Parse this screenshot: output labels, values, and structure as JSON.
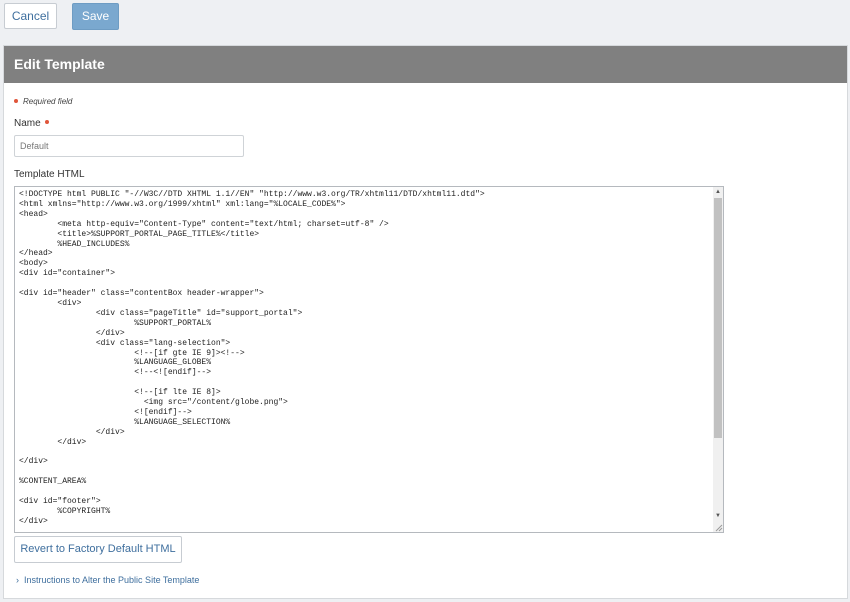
{
  "toolbar": {
    "cancel_label": "Cancel",
    "save_label": "Save"
  },
  "panel": {
    "title": "Edit Template",
    "required_note": "Required field",
    "name_label": "Name",
    "name_value": "Default",
    "template_label": "Template HTML",
    "template_html": "<!DOCTYPE html PUBLIC \"-//W3C//DTD XHTML 1.1//EN\" \"http://www.w3.org/TR/xhtml11/DTD/xhtml11.dtd\">\n<html xmlns=\"http://www.w3.org/1999/xhtml\" xml:lang=\"%LOCALE_CODE%\">\n<head>\n        <meta http-equiv=\"Content-Type\" content=\"text/html; charset=utf-8\" />\n        <title>%SUPPORT_PORTAL_PAGE_TITLE%</title>\n        %HEAD_INCLUDES%\n</head>\n<body>\n<div id=\"container\">\n\n<div id=\"header\" class=\"contentBox header-wrapper\">\n        <div>\n                <div class=\"pageTitle\" id=\"support_portal\">\n                        %SUPPORT_PORTAL%\n                </div>\n                <div class=\"lang-selection\">\n                        <!--[if gte IE 9]><!-->\n                        %LANGUAGE_GLOBE%\n                        <!--<![endif]-->\n\n                        <!--[if lte IE 8]>\n                          <img src=\"/content/globe.png\">\n                        <![endif]-->\n                        %LANGUAGE_SELECTION%\n                </div>\n        </div>\n\n</div>\n\n%CONTENT_AREA%\n\n<div id=\"footer\">\n        %COPYRIGHT%\n</div>",
    "revert_label": "Revert to Factory Default HTML",
    "instructions_label": "Instructions to Alter the Public Site Template"
  },
  "icons": {
    "required_dot": "required-dot-icon",
    "scroll_up": "chevron-up-icon",
    "scroll_down": "chevron-down-icon",
    "resize": "resize-grip-icon",
    "expand": "chevron-right-icon"
  },
  "colors": {
    "header_bg": "#808080",
    "save_bg": "#7aa8cf",
    "link": "#3f6f9e",
    "required": "#e0553a",
    "page_bg": "#eef0f3"
  }
}
